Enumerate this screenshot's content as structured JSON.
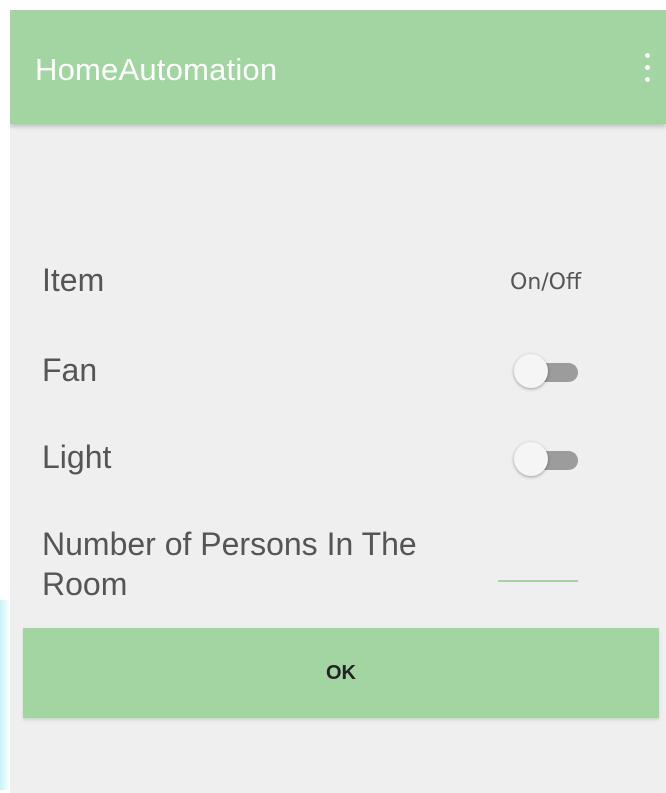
{
  "appbar": {
    "title": "HomeAutomation",
    "menu_icon": "more-vert-icon"
  },
  "table": {
    "header_item": "Item",
    "header_state": "On/Off",
    "rows": [
      {
        "label": "Fan",
        "switch_on": false
      },
      {
        "label": "Light",
        "switch_on": false
      }
    ]
  },
  "persons": {
    "label": "Number of Persons In The Room",
    "value": ""
  },
  "ok_button": {
    "label": "OK"
  },
  "colors": {
    "accent": "#a2d5a2",
    "background": "#efefef",
    "text": "#555555",
    "switch_track": "#9c9c9c",
    "switch_thumb": "#f5f5f5"
  }
}
